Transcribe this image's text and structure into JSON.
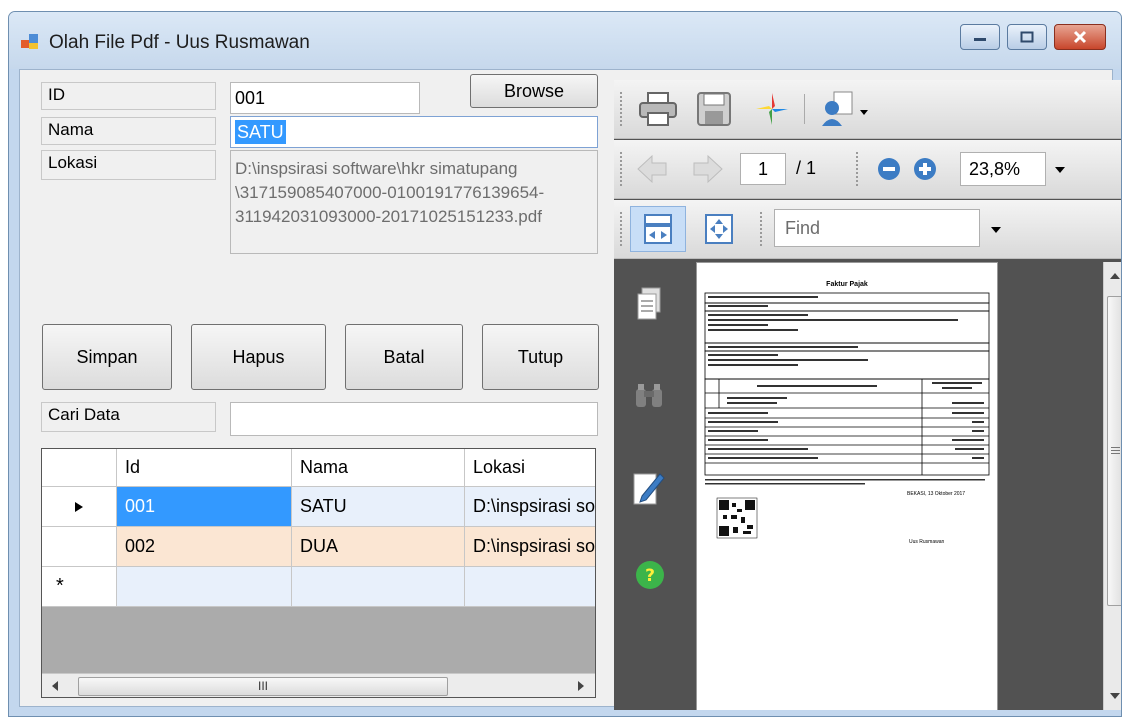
{
  "window": {
    "title": "Olah File Pdf - Uus Rusmawan"
  },
  "form": {
    "id_label": "ID",
    "id_value": "001",
    "nama_label": "Nama",
    "nama_value": "SATU",
    "lokasi_label": "Lokasi",
    "lokasi_line1": "D:\\inspsirasi software\\hkr simatupang",
    "lokasi_line2": "\\317159085407000-0100191776139654-",
    "lokasi_line3": "311942031093000-20171025151233.pdf",
    "browse_label": "Browse",
    "cari_label": "Cari Data",
    "cari_value": ""
  },
  "buttons": {
    "simpan": "Simpan",
    "hapus": "Hapus",
    "batal": "Batal",
    "tutup": "Tutup"
  },
  "grid": {
    "headers": [
      "Id",
      "Nama",
      "Lokasi"
    ],
    "rows": [
      [
        "001",
        "SATU",
        "D:\\inspsirasi so"
      ],
      [
        "002",
        "DUA",
        "D:\\inspsirasi so"
      ]
    ],
    "new_row_marker": "*",
    "current_row_marker": "▶",
    "hscroll_thumb_glyph": "III"
  },
  "pdf_viewer": {
    "page_current": "1",
    "page_total": "/ 1",
    "zoom": "23,8%",
    "find_placeholder": "Find",
    "document": {
      "title": "Faktur Pajak",
      "location_date": "BEKASI, 13 Oktober 2017",
      "signer": "Uus Rusmawan"
    }
  },
  "colors": {
    "selected_cell": "#3399ff",
    "row_alt": "#fbe6d3",
    "row_normal": "#e8f0fb",
    "help_icon": "#3cb44a"
  }
}
